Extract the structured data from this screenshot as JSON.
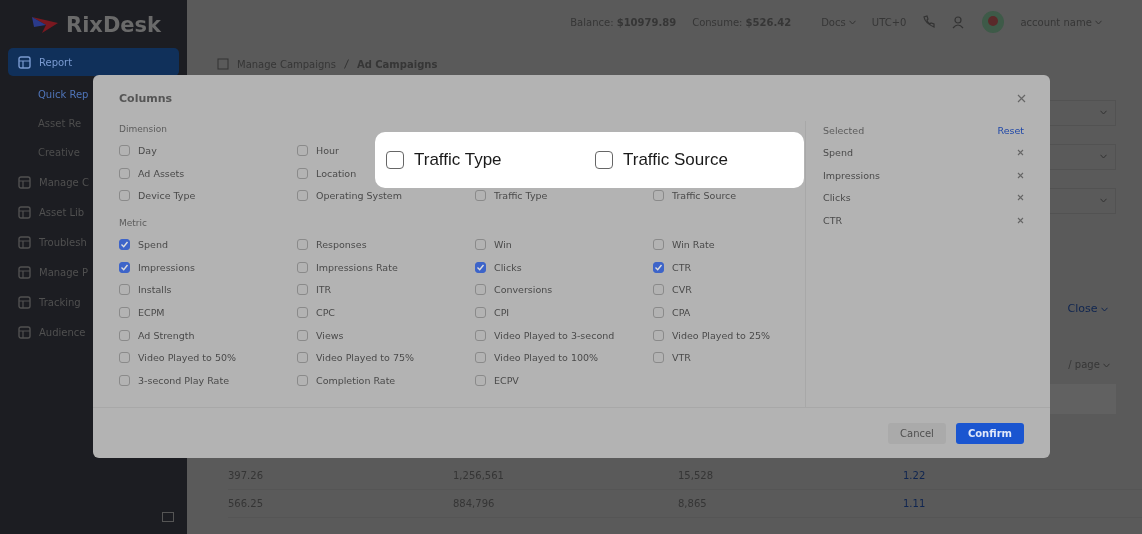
{
  "sidebar": {
    "logo": "RixDesk",
    "items": [
      {
        "label": "Report",
        "selected": true,
        "children": [
          {
            "label": "Quick Rep",
            "selected": true
          },
          {
            "label": "Asset Re",
            "selected": false
          },
          {
            "label": "Creative",
            "selected": false
          }
        ]
      },
      {
        "label": "Manage C",
        "selected": false
      },
      {
        "label": "Asset Lib",
        "selected": false
      },
      {
        "label": "Troublesh",
        "selected": false
      },
      {
        "label": "Manage P",
        "selected": false
      },
      {
        "label": "Tracking",
        "selected": false
      },
      {
        "label": "Audience",
        "selected": false
      }
    ]
  },
  "topbar": {
    "balance": "Balance: **$10979.89**",
    "consume": "Consume: **$526.42**",
    "docs": "Docs",
    "timezone": "UTC+0",
    "account": "account name"
  },
  "breadcrumb": [
    "Manage Campaigns",
    "Ad Campaigns"
  ],
  "page": {
    "link": "Close",
    "page_size": "/ page",
    "rows": [
      [
        "397.26",
        "1,256,561",
        "15,528",
        "1.22"
      ],
      [
        "566.25",
        "884,796",
        "8,865",
        "1.11"
      ]
    ]
  },
  "modal": {
    "title": "Columns",
    "sections": [
      {
        "label": "Dimension",
        "options": [
          {
            "label": "Day",
            "checked": false
          },
          {
            "label": "Hour",
            "checked": false
          },
          {
            "label": "Ad Assets",
            "checked": false
          },
          {
            "label": "Location",
            "checked": false
          },
          {
            "label": "Device Type",
            "checked": false
          },
          {
            "label": "Operating System",
            "checked": false
          },
          {
            "label": "Traffic Type",
            "checked": false
          },
          {
            "label": "Traffic Source",
            "checked": false
          }
        ]
      },
      {
        "label": "Metric",
        "options": [
          {
            "label": "Spend",
            "checked": true
          },
          {
            "label": "Responses",
            "checked": false
          },
          {
            "label": "Win",
            "checked": false
          },
          {
            "label": "Win Rate",
            "checked": false
          },
          {
            "label": "Impressions",
            "checked": true
          },
          {
            "label": "Impressions Rate",
            "checked": false
          },
          {
            "label": "Clicks",
            "checked": true
          },
          {
            "label": "CTR",
            "checked": true
          },
          {
            "label": "Installs",
            "checked": false
          },
          {
            "label": "ITR",
            "checked": false
          },
          {
            "label": "Conversions",
            "checked": false
          },
          {
            "label": "CVR",
            "checked": false
          },
          {
            "label": "ECPM",
            "checked": false
          },
          {
            "label": "CPC",
            "checked": false
          },
          {
            "label": "CPI",
            "checked": false
          },
          {
            "label": "CPA",
            "checked": false
          },
          {
            "label": "Ad Strength",
            "checked": false
          },
          {
            "label": "Views",
            "checked": false
          },
          {
            "label": "Video Played to 3-second",
            "checked": false
          },
          {
            "label": "Video Played to 25%",
            "checked": false
          },
          {
            "label": "Video Played to 50%",
            "checked": false
          },
          {
            "label": "Video Played to 75%",
            "checked": false
          },
          {
            "label": "Video Played to 100%",
            "checked": false
          },
          {
            "label": "VTR",
            "checked": false
          },
          {
            "label": "3-second Play Rate",
            "checked": false
          },
          {
            "label": "Completion Rate",
            "checked": false
          },
          {
            "label": "ECPV",
            "checked": false
          }
        ]
      }
    ],
    "selected_title": "Selected",
    "reset": "Reset",
    "selected": [
      "Spend",
      "Impressions",
      "Clicks",
      "CTR"
    ],
    "buttons": [
      "Cancel",
      "Confirm"
    ]
  },
  "callout": [
    {
      "label": "Traffic Type",
      "checked": false
    },
    {
      "label": "Traffic Source",
      "checked": false
    }
  ]
}
